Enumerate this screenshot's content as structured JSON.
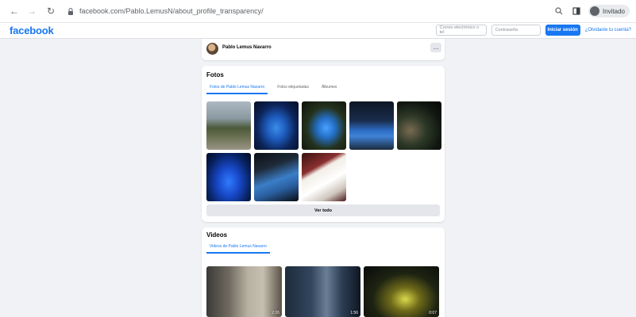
{
  "browser": {
    "url": "facebook.com/Pablo.LemusN/about_profile_transparency/",
    "profile_label": "Invitado"
  },
  "facebook": {
    "logo": "facebook",
    "email_placeholder": "Correo electrónico o tel",
    "password_placeholder": "Contraseña",
    "login_button": "Iniciar sesión",
    "forgot_link": "¿Olvidaste tu cuenta?"
  },
  "profile": {
    "name": "Pablo Lemus Navarro",
    "more_label": "…"
  },
  "fotos": {
    "title": "Fotos",
    "tabs": [
      "Fotos de Pablo Lemus Navarro",
      "Fotos etiquetadas",
      "Álbumes"
    ],
    "active_tab": 0,
    "photo_count": 8,
    "see_all": "Ver todo"
  },
  "videos": {
    "title": "Videos",
    "tabs": [
      "Videos de Pablo Lemus Navarro"
    ],
    "items": [
      {
        "duration": "2:26"
      },
      {
        "duration": "1:56"
      },
      {
        "duration": "0:07"
      }
    ]
  },
  "colors": {
    "brand": "#1877f2",
    "page_bg": "#f0f2f5",
    "card_bg": "#ffffff"
  }
}
